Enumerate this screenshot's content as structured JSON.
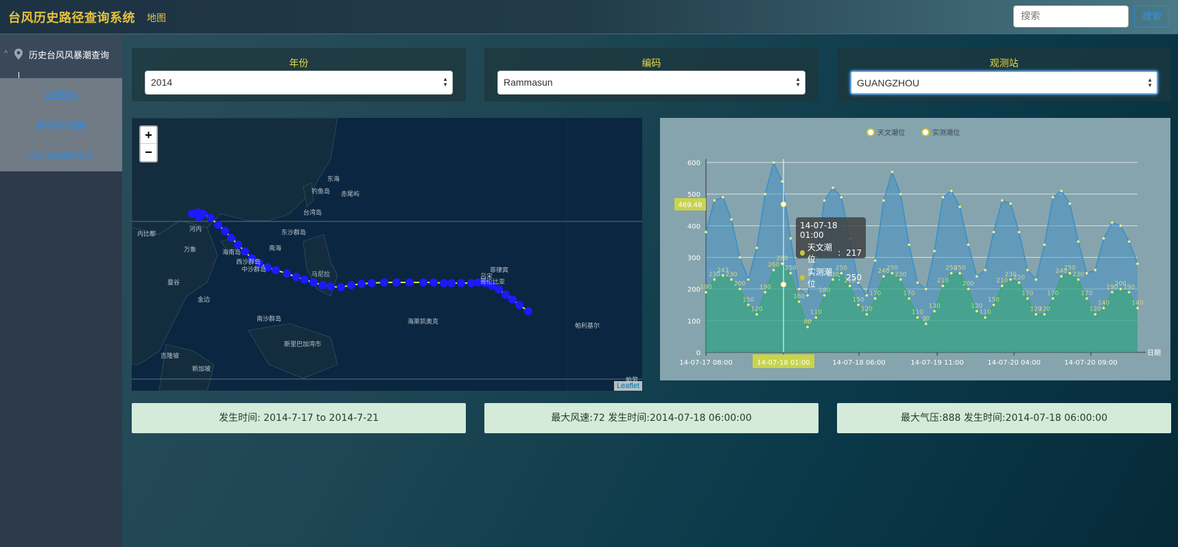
{
  "header": {
    "title": "台风历史路径查询系统",
    "nav_map": "地图",
    "search_placeholder": "搜索",
    "search_button": "搜索"
  },
  "sidebar": {
    "section_title": "历史台风风暴潮查询",
    "items": [
      {
        "label": "范围搜索"
      },
      {
        "label": "复杂条件搜索"
      },
      {
        "label": "历史测站数据查询"
      }
    ]
  },
  "filters": {
    "year": {
      "label": "年份",
      "value": "2014"
    },
    "code": {
      "label": "编码",
      "value": "Rammasun"
    },
    "station": {
      "label": "观测站",
      "value": "GUANGZHOU"
    }
  },
  "map": {
    "attribution": "Leaflet",
    "labels": [
      "东海",
      "钓鱼岛",
      "赤尾屿",
      "台湾岛",
      "河内",
      "内比都",
      "东沙群岛",
      "南海",
      "万象",
      "海南岛",
      "西沙群岛",
      "中沙群岛",
      "马尼拉",
      "菲律宾",
      "哥伦比亚",
      "吕宋",
      "曼谷",
      "金边",
      "南沙群岛",
      "斯里巴加湾市",
      "吉隆坡",
      "新加坡",
      "帕劳",
      "海萊凯奥克",
      "帕利基尔"
    ]
  },
  "chart_data": {
    "type": "area",
    "legend": [
      "天文潮位",
      "实测潮位"
    ],
    "xlabel": "日期",
    "ylim": [
      0,
      600
    ],
    "yticks": [
      0,
      100,
      200,
      300,
      400,
      500,
      600
    ],
    "xticks": [
      "14-07-17 08:00",
      "14-07-18 01:00",
      "14-07-18 06:00",
      "14-07-19 11:00",
      "14-07-20 04:00",
      "14-07-20 09:00"
    ],
    "axis_pointer_y": "469.48",
    "axis_pointer_x": "14-07-18 01:00",
    "series": [
      {
        "name": "天文潮位",
        "color": "#3a8fc8",
        "values": [
          380,
          480,
          490,
          420,
          300,
          230,
          330,
          500,
          600,
          540,
          360,
          200,
          180,
          300,
          480,
          520,
          490,
          360,
          220,
          180,
          290,
          480,
          570,
          500,
          340,
          220,
          200,
          320,
          490,
          510,
          460,
          340,
          240,
          260,
          380,
          480,
          470,
          380,
          260,
          230,
          340,
          490,
          510,
          470,
          350,
          250,
          260,
          360,
          410,
          400,
          350,
          280
        ]
      },
      {
        "name": "实测潮位",
        "color": "#3aa86a",
        "values": [
          190,
          230,
          243,
          230,
          200,
          150,
          120,
          190,
          260,
          280,
          250,
          160,
          80,
          110,
          180,
          230,
          250,
          210,
          150,
          120,
          170,
          240,
          250,
          230,
          170,
          110,
          90,
          130,
          210,
          250,
          250,
          200,
          130,
          110,
          150,
          210,
          230,
          220,
          170,
          120,
          120,
          170,
          240,
          250,
          230,
          170,
          120,
          140,
          190,
          200,
          190,
          140
        ]
      }
    ],
    "tooltip": {
      "title": "14-07-18 01:00",
      "rows": [
        {
          "label": "天文潮位",
          "value": "217"
        },
        {
          "label": "实测潮位",
          "value": "250"
        }
      ]
    }
  },
  "info": {
    "time": "发生时间: 2014-7-17 to 2014-7-21",
    "max_wind": "最大风速:72  发生时间:2014-07-18 06:00:00",
    "min_pressure": "最大气压:888  发生时间:2014-07-18 06:00:00"
  },
  "colors": {
    "brand": "#e6c23e",
    "track": "#1a1aff",
    "track_line": "#e6e63a"
  }
}
